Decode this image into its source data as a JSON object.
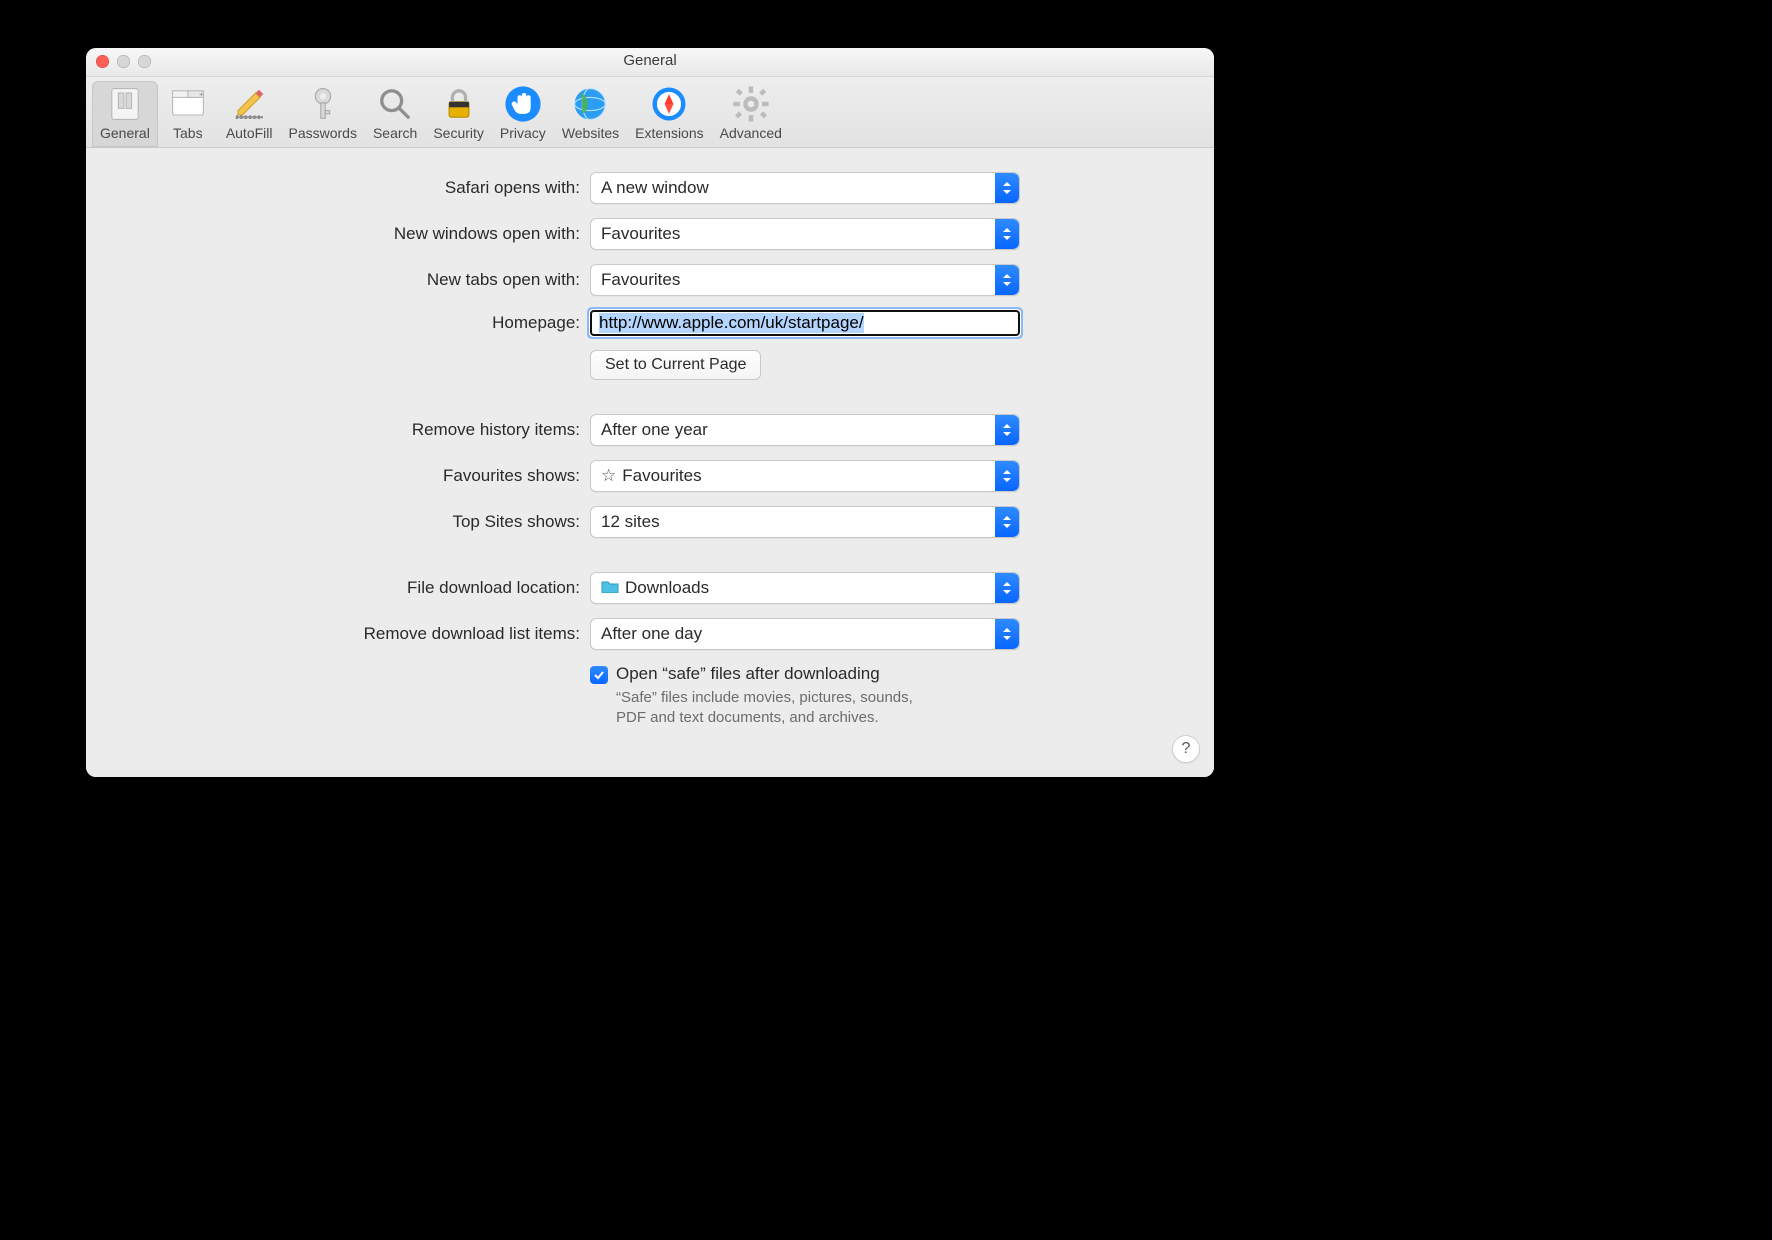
{
  "window": {
    "title": "General"
  },
  "toolbar": {
    "items": [
      {
        "label": "General"
      },
      {
        "label": "Tabs"
      },
      {
        "label": "AutoFill"
      },
      {
        "label": "Passwords"
      },
      {
        "label": "Search"
      },
      {
        "label": "Security"
      },
      {
        "label": "Privacy"
      },
      {
        "label": "Websites"
      },
      {
        "label": "Extensions"
      },
      {
        "label": "Advanced"
      }
    ]
  },
  "labels": {
    "opens_with": "Safari opens with:",
    "new_windows": "New windows open with:",
    "new_tabs": "New tabs open with:",
    "homepage": "Homepage:",
    "set_current": "Set to Current Page",
    "remove_history": "Remove history items:",
    "favourites_shows": "Favourites shows:",
    "top_sites": "Top Sites shows:",
    "download_location": "File download location:",
    "remove_downloads": "Remove download list items:",
    "open_safe": "Open “safe” files after downloading",
    "safe_help": "“Safe” files include movies, pictures, sounds, PDF and text documents, and archives."
  },
  "values": {
    "opens_with": "A new window",
    "new_windows": "Favourites",
    "new_tabs": "Favourites",
    "homepage": "http://www.apple.com/uk/startpage/",
    "remove_history": "After one year",
    "favourites_shows": "Favourites",
    "top_sites": "12 sites",
    "download_location": "Downloads",
    "remove_downloads": "After one day"
  },
  "help_button": "?"
}
